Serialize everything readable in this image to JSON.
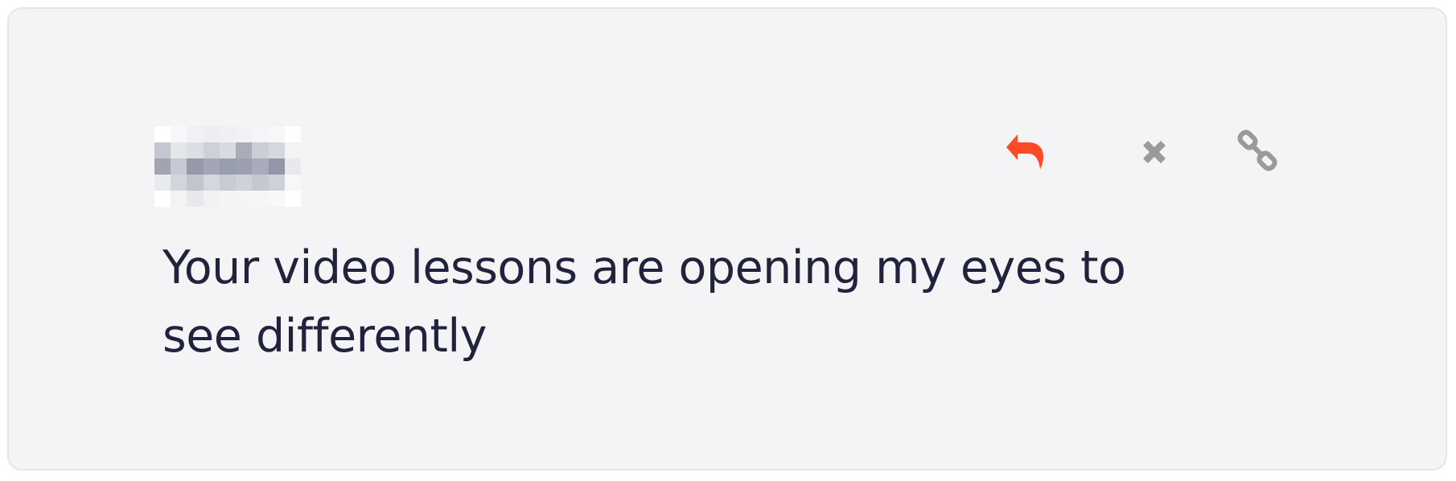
{
  "comment": {
    "text": "Your video lessons are opening my eyes to see differently"
  },
  "actions": {
    "reply_icon": "reply-icon",
    "delete_icon": "close-icon",
    "link_icon": "link-icon"
  },
  "colors": {
    "card_background": "#f4f4f7",
    "card_border": "#e6e6ea",
    "text": "#21223b",
    "reply_accent": "#ff4a25",
    "icon_gray": "#9a9a9a"
  }
}
